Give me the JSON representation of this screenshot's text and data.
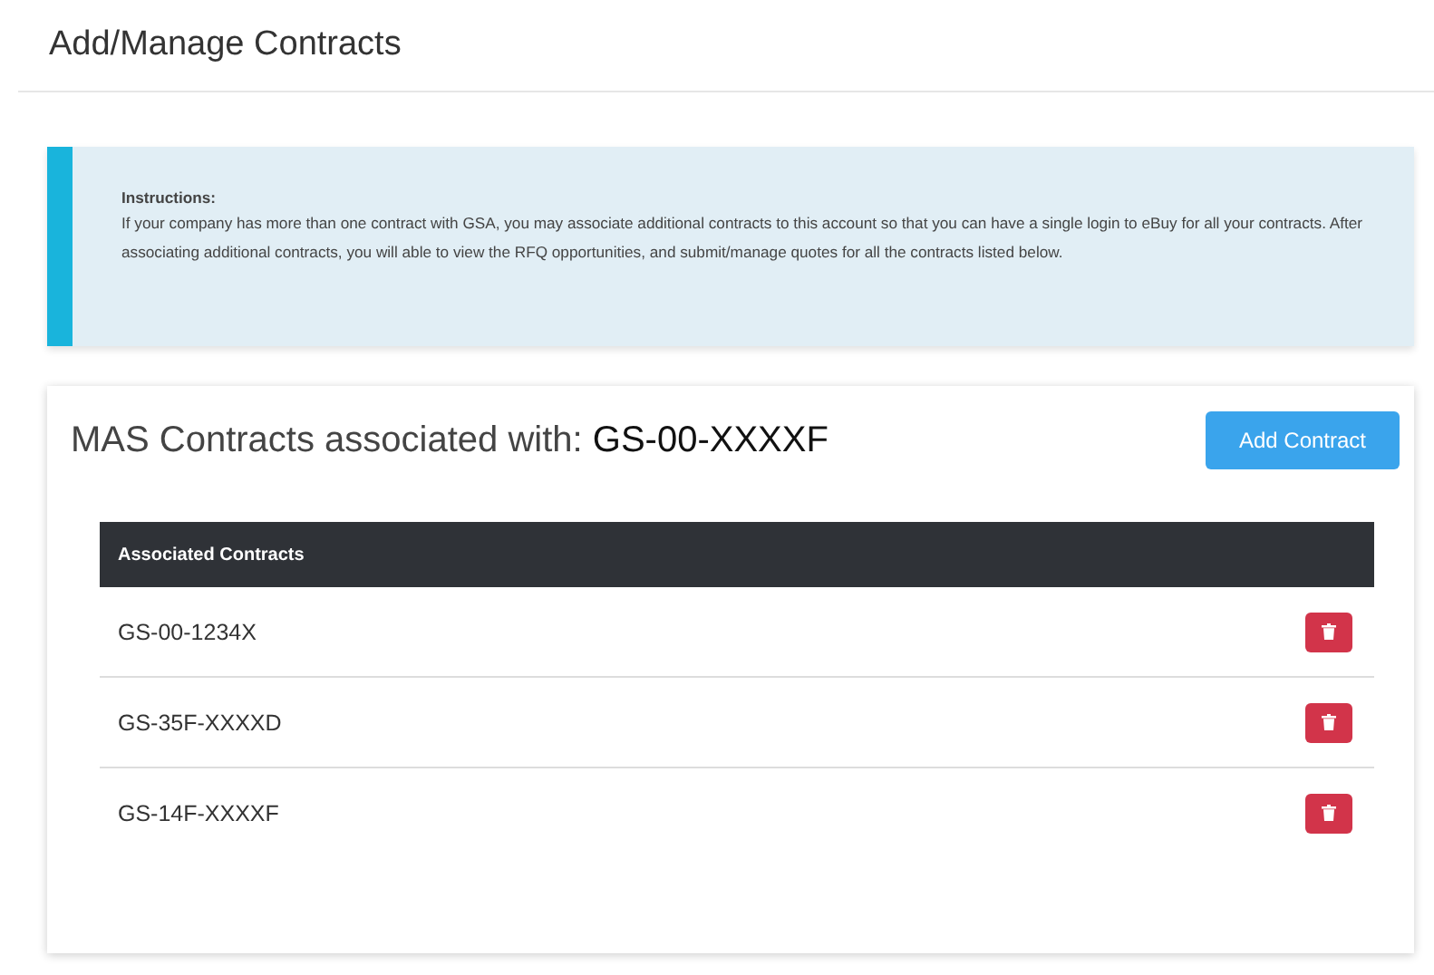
{
  "page": {
    "title": "Add/Manage Contracts"
  },
  "instructions": {
    "heading": "Instructions:",
    "text": "If your company has more than one contract with GSA, you may associate additional contracts to this account so that you can have a single login to eBuy for all your contracts. After associating additional contracts, you will able to view the RFQ opportunities, and submit/manage quotes for all the contracts listed below."
  },
  "card": {
    "heading": "MAS Contracts associated with:",
    "contract": "GS-00-XXXXF",
    "add_button": "Add Contract"
  },
  "table": {
    "columns": [
      "Associated Contracts"
    ],
    "rows": [
      {
        "contract": "GS-00-1234X"
      },
      {
        "contract": "GS-35F-XXXXD"
      },
      {
        "contract": "GS-14F-XXXXF"
      }
    ]
  }
}
